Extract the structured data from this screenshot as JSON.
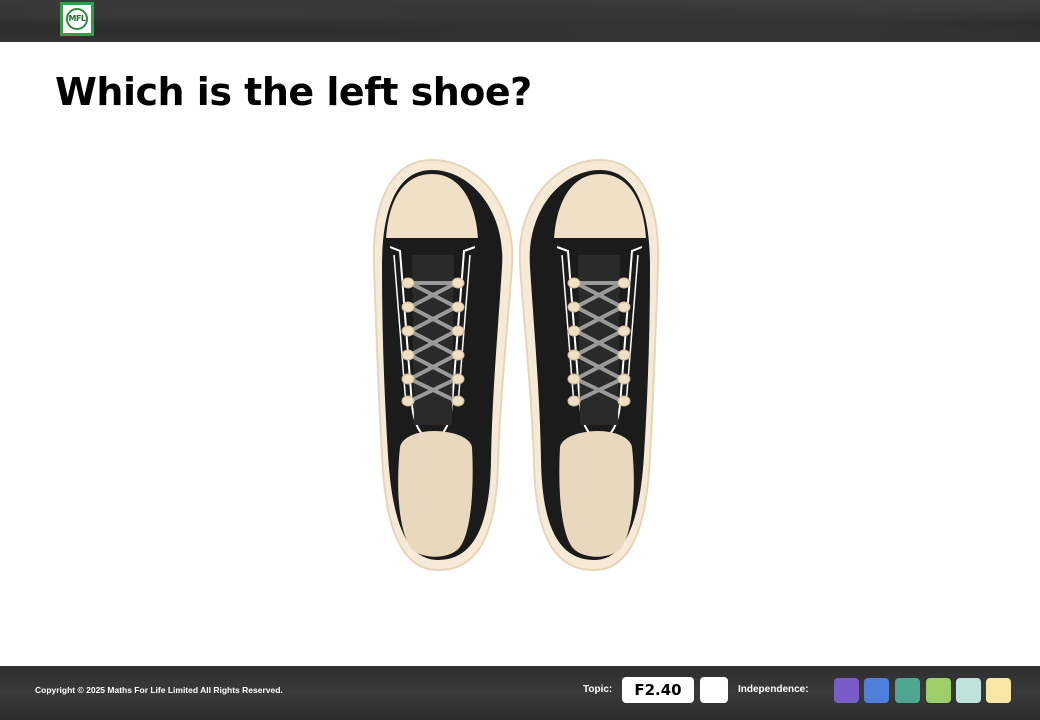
{
  "header": {
    "logo_text": "MFL"
  },
  "question": {
    "title": "Which is the left shoe?"
  },
  "footer": {
    "copyright": "Copyright © 2025 Maths For Life Limited All Rights Reserved.",
    "topic_label": "Topic:",
    "topic_code": "F2.40",
    "independence_label": "Independence:",
    "independence_colors": [
      "#7a5cc9",
      "#4f7fdb",
      "#4ea592",
      "#9ccf6a",
      "#bfe3dc",
      "#f7e6a6"
    ]
  },
  "colors": {
    "shoe_black": "#1b1b1b",
    "shoe_cream": "#e8d8bd",
    "shoe_sole": "#f6ead6",
    "lace_grey": "#9a9a9a"
  }
}
